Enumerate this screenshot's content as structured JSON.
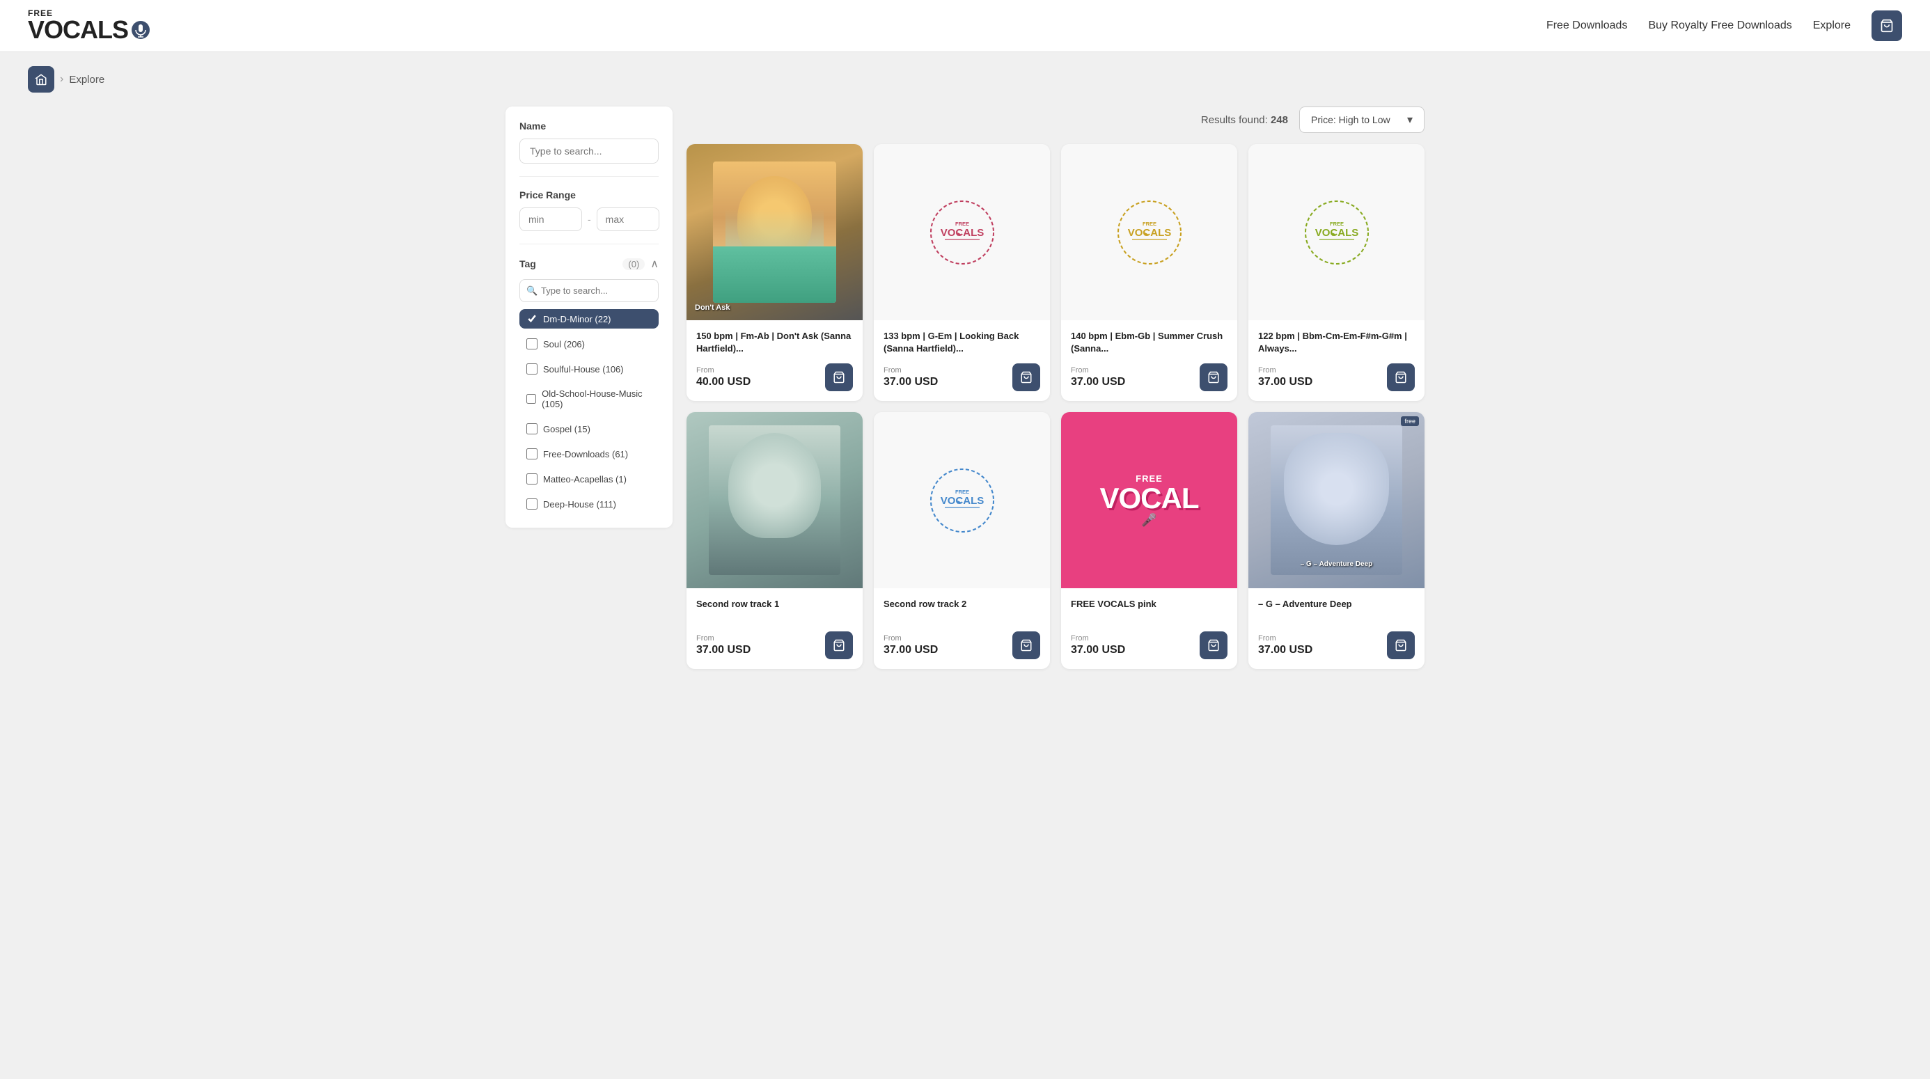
{
  "header": {
    "logo_free": "FREE",
    "logo_main": "VOCALS",
    "nav": {
      "free_downloads": "Free Downloads",
      "buy_royalty": "Buy Royalty Free Downloads",
      "explore": "Explore"
    }
  },
  "breadcrumb": {
    "home_icon": "⌂",
    "separator": "›",
    "label": "Explore"
  },
  "sidebar": {
    "name_label": "Name",
    "name_placeholder": "Type to search...",
    "price_range_label": "Price Range",
    "price_min_placeholder": "min",
    "price_max_placeholder": "max",
    "tag_label": "Tag",
    "tag_count": "(0)",
    "tag_search_placeholder": "Type to search...",
    "tags": [
      {
        "name": "Dm-D-Minor (22)",
        "active": true
      },
      {
        "name": "Soul (206)",
        "active": false
      },
      {
        "name": "Soulful-House (106)",
        "active": false
      },
      {
        "name": "Old-School-House-Music (105)",
        "active": false
      },
      {
        "name": "Gospel (15)",
        "active": false
      },
      {
        "name": "Free-Downloads (61)",
        "active": false
      },
      {
        "name": "Matteo-Acapellas (1)",
        "active": false
      },
      {
        "name": "Deep-House (111)",
        "active": false
      }
    ]
  },
  "results": {
    "label": "Results found:",
    "count": "248",
    "sort_label": "Price: High to Low"
  },
  "cards": [
    {
      "id": 1,
      "title": "150 bpm | Fm-Ab | Don't Ask (Sanna Hartfield)...",
      "from_label": "From",
      "price": "40.00 USD",
      "has_image": true,
      "image_bg": "#555",
      "image_style": "person"
    },
    {
      "id": 2,
      "title": "133 bpm | G-Em | Looking Back (Sanna Hartfield)...",
      "from_label": "From",
      "price": "37.00 USD",
      "has_image": false,
      "logo_color": "#c04060"
    },
    {
      "id": 3,
      "title": "140 bpm | Ebm-Gb | Summer Crush (Sanna...",
      "from_label": "From",
      "price": "37.00 USD",
      "has_image": false,
      "logo_color": "#c8a020"
    },
    {
      "id": 4,
      "title": "122 bpm | Bbm-Cm-Em-F#m-G#m | Always...",
      "from_label": "From",
      "price": "37.00 USD",
      "has_image": false,
      "logo_color": "#88aa20"
    },
    {
      "id": 5,
      "title": "Second row track 1",
      "from_label": "From",
      "price": "37.00 USD",
      "has_image": true,
      "image_style": "person2"
    },
    {
      "id": 6,
      "title": "Second row track 2",
      "from_label": "From",
      "price": "37.00 USD",
      "has_image": false,
      "logo_color": "#4488cc"
    },
    {
      "id": 7,
      "title": "FREE VOCALS pink",
      "from_label": "From",
      "price": "37.00 USD",
      "has_image": true,
      "image_style": "pink"
    },
    {
      "id": 8,
      "title": "– G – Adventure Deep",
      "from_label": "From",
      "price": "37.00 USD",
      "has_image": true,
      "image_style": "person3"
    }
  ]
}
